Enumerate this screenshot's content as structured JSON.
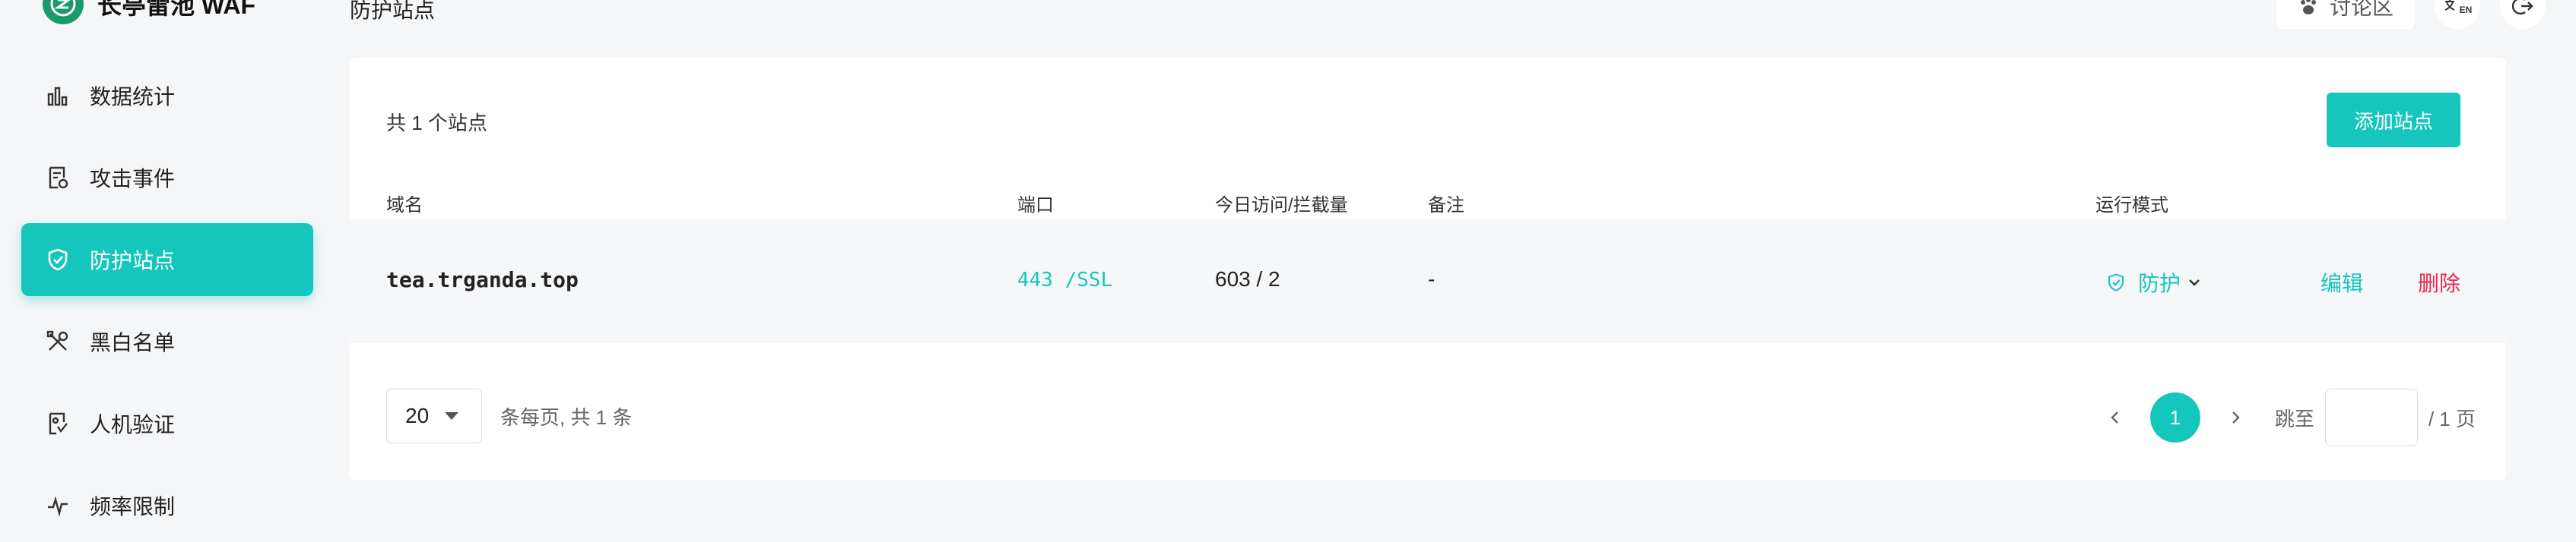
{
  "app": {
    "name": "长亭雷池 WAF"
  },
  "sidebar": {
    "items": [
      {
        "label": "数据统计",
        "icon": "bar-chart-icon",
        "active": false
      },
      {
        "label": "攻击事件",
        "icon": "document-alert-icon",
        "active": false
      },
      {
        "label": "防护站点",
        "icon": "shield-icon",
        "active": true
      },
      {
        "label": "黑白名单",
        "icon": "tools-icon",
        "active": false
      },
      {
        "label": "人机验证",
        "icon": "verify-user-icon",
        "active": false
      },
      {
        "label": "频率限制",
        "icon": "pulse-icon",
        "active": false
      }
    ]
  },
  "header": {
    "title": "防护站点",
    "forum_label": "讨论区",
    "lang_badge": "EN"
  },
  "main": {
    "summary": "共 1 个站点",
    "add_button": "添加站点",
    "columns": [
      "域名",
      "端口",
      "今日访问/拦截量",
      "备注",
      "运行模式"
    ],
    "rows": [
      {
        "domain": "tea.trganda.top",
        "port": "443 /SSL",
        "visits": "603 / 2",
        "note": "-",
        "mode": "防护",
        "edit": "编辑",
        "delete": "删除"
      }
    ]
  },
  "pagination": {
    "page_size": "20",
    "per_page_text": "条每页, 共 1 条",
    "current_page": "1",
    "jump_label": "跳至",
    "total_pages_text": "/ 1 页"
  },
  "colors": {
    "accent": "#15c6bd",
    "danger": "#e8294f",
    "logo": "#1a9a6b"
  }
}
